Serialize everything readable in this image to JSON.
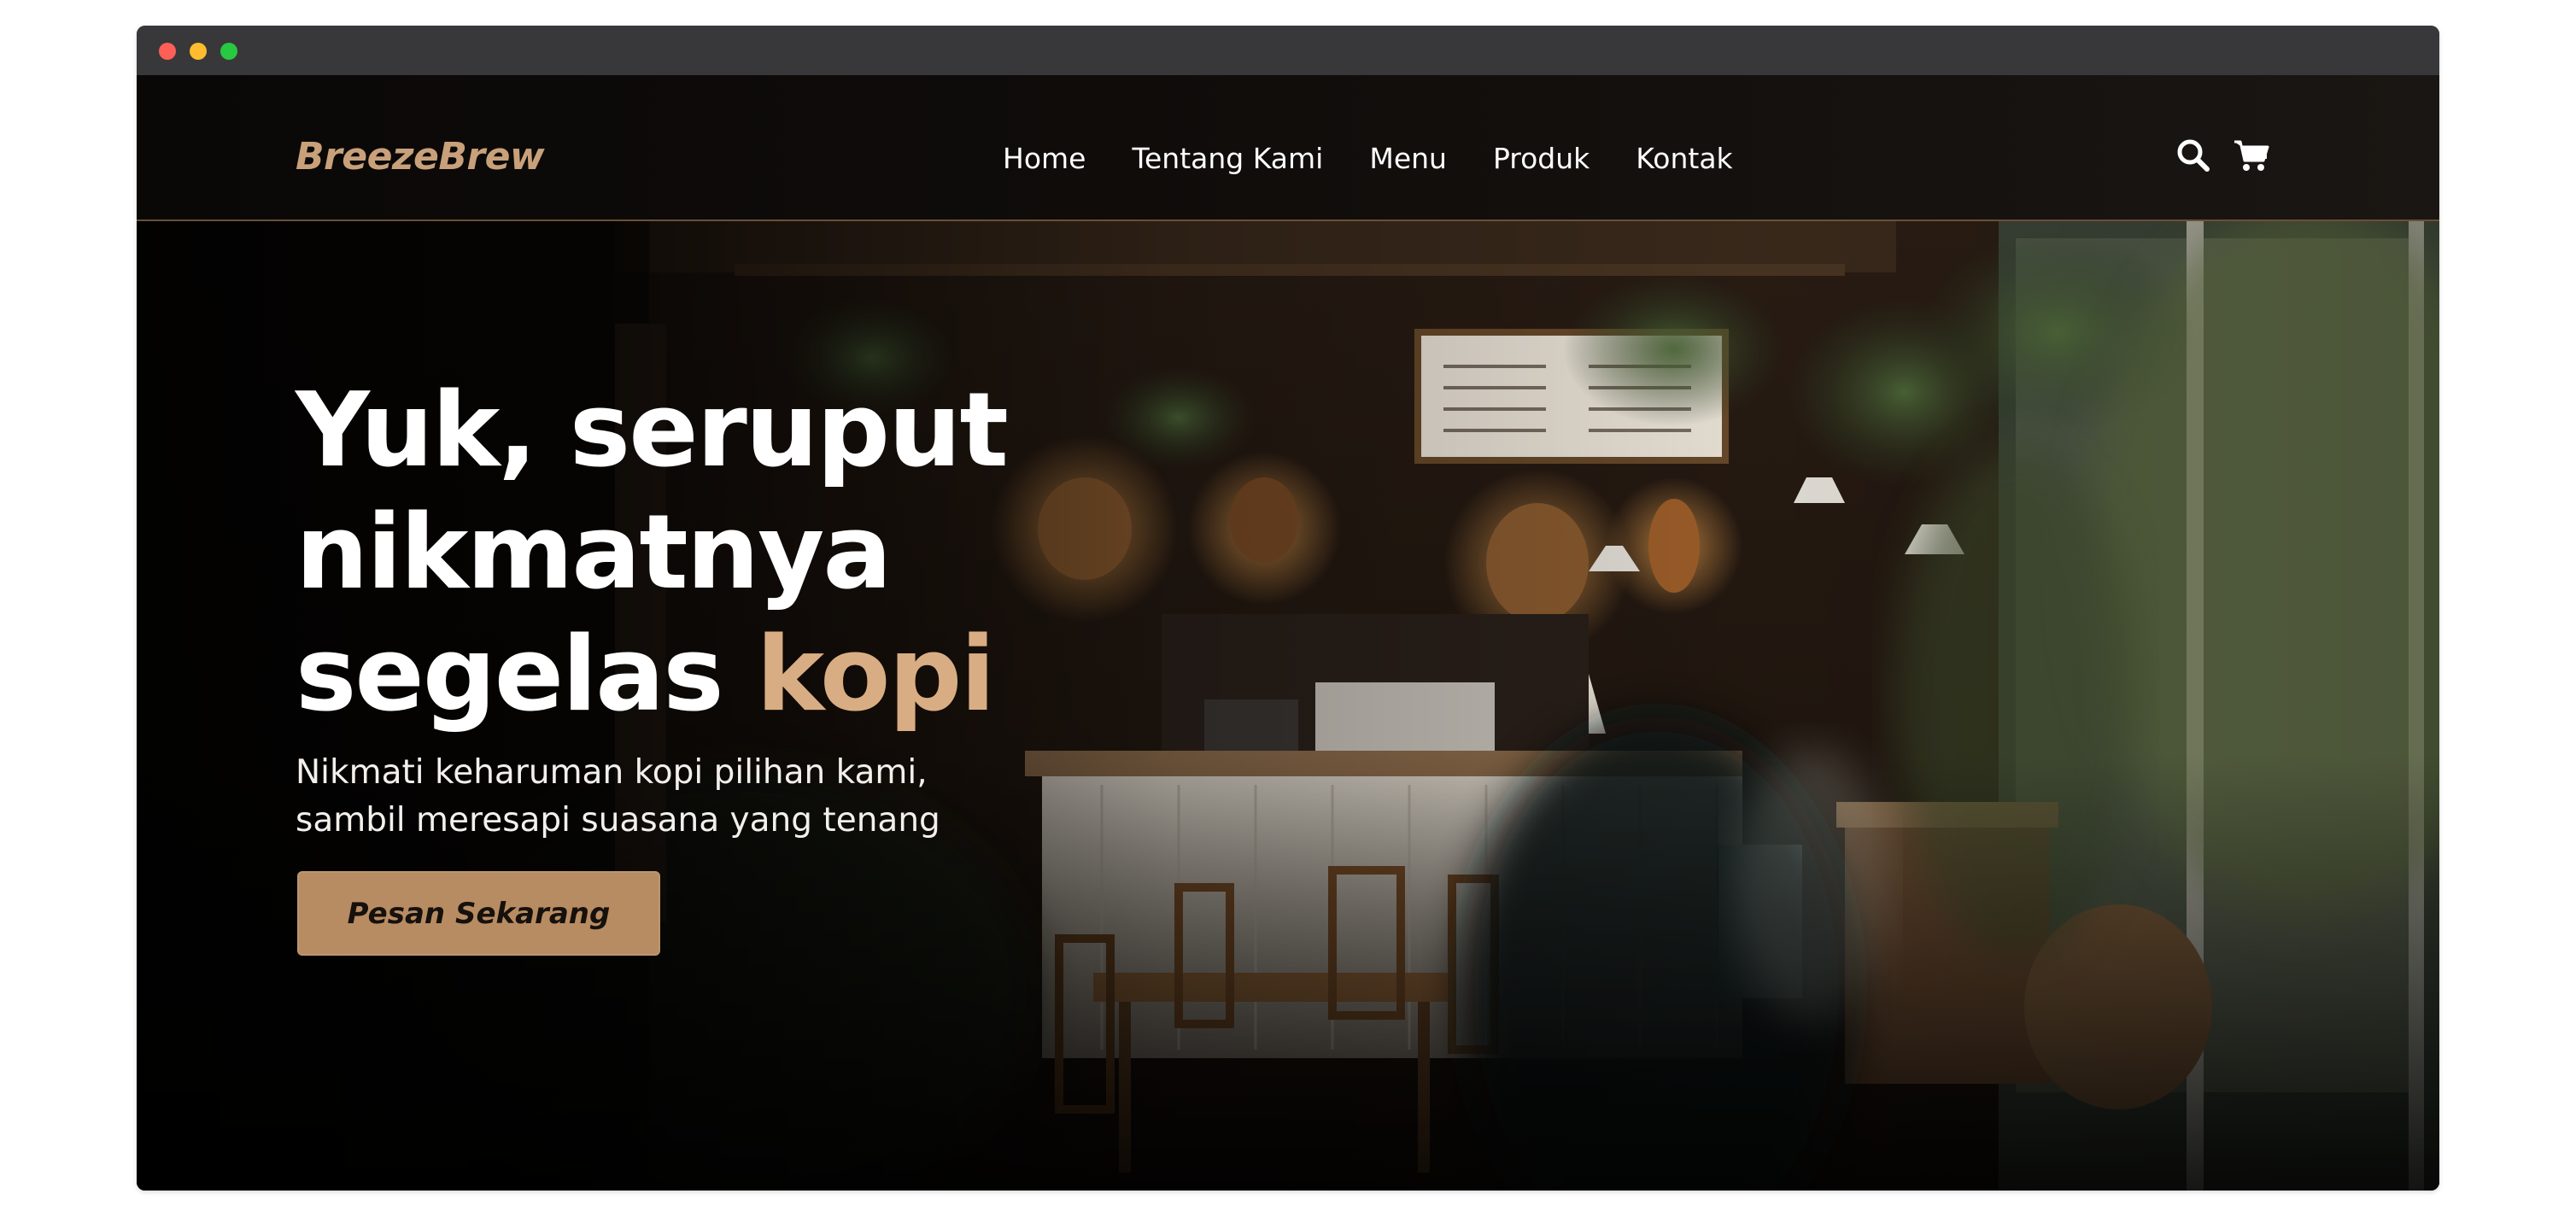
{
  "window": {
    "controls": [
      "close",
      "minimize",
      "zoom"
    ]
  },
  "nav": {
    "logo": "BreezeBrew",
    "links": [
      "Home",
      "Tentang Kami",
      "Menu",
      "Produk",
      "Kontak"
    ],
    "icons": [
      "search-icon",
      "cart-icon"
    ]
  },
  "hero": {
    "title_line1": "Yuk, seruput",
    "title_line2": "nikmatnya",
    "title_line3_prefix": "segelas ",
    "title_line3_accent": "kopi",
    "subtitle_line1": "Nikmati keharuman kopi pilihan kami,",
    "subtitle_line2": "sambil meresapi suasana yang tenang",
    "cta_label": "Pesan Sekarang",
    "background_description": "cafe-interior-photo"
  },
  "colors": {
    "accent": "#d9ad83",
    "logo": "#c8a07a",
    "button": "#b88c62",
    "nav_bg": "#0c0a09",
    "titlebar": "#38383a"
  }
}
